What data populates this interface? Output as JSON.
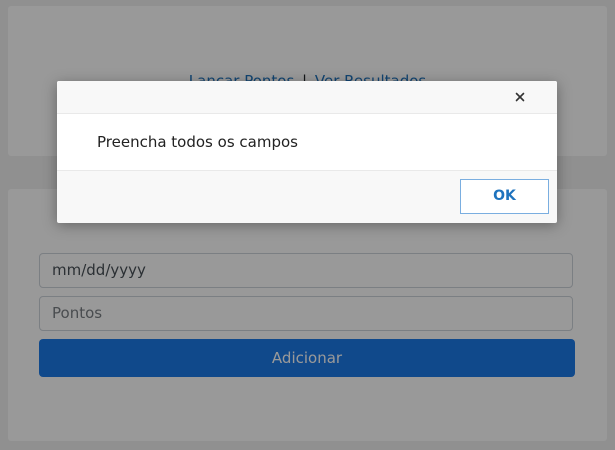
{
  "nav": {
    "link_lancar": "Lançar Pontos",
    "separator": "|",
    "link_resultados": "Ver Resultados"
  },
  "form": {
    "date_value": "mm/dd/yyyy",
    "points_placeholder": "Pontos",
    "add_label": "Adicionar"
  },
  "dialog": {
    "close_icon": "close-icon",
    "message": "Preencha todos os campos",
    "ok_label": "OK"
  },
  "colors": {
    "primary_button": "#1c7ae8",
    "link": "#1e73be",
    "overlay": "rgba(0,0,0,0.4)"
  }
}
